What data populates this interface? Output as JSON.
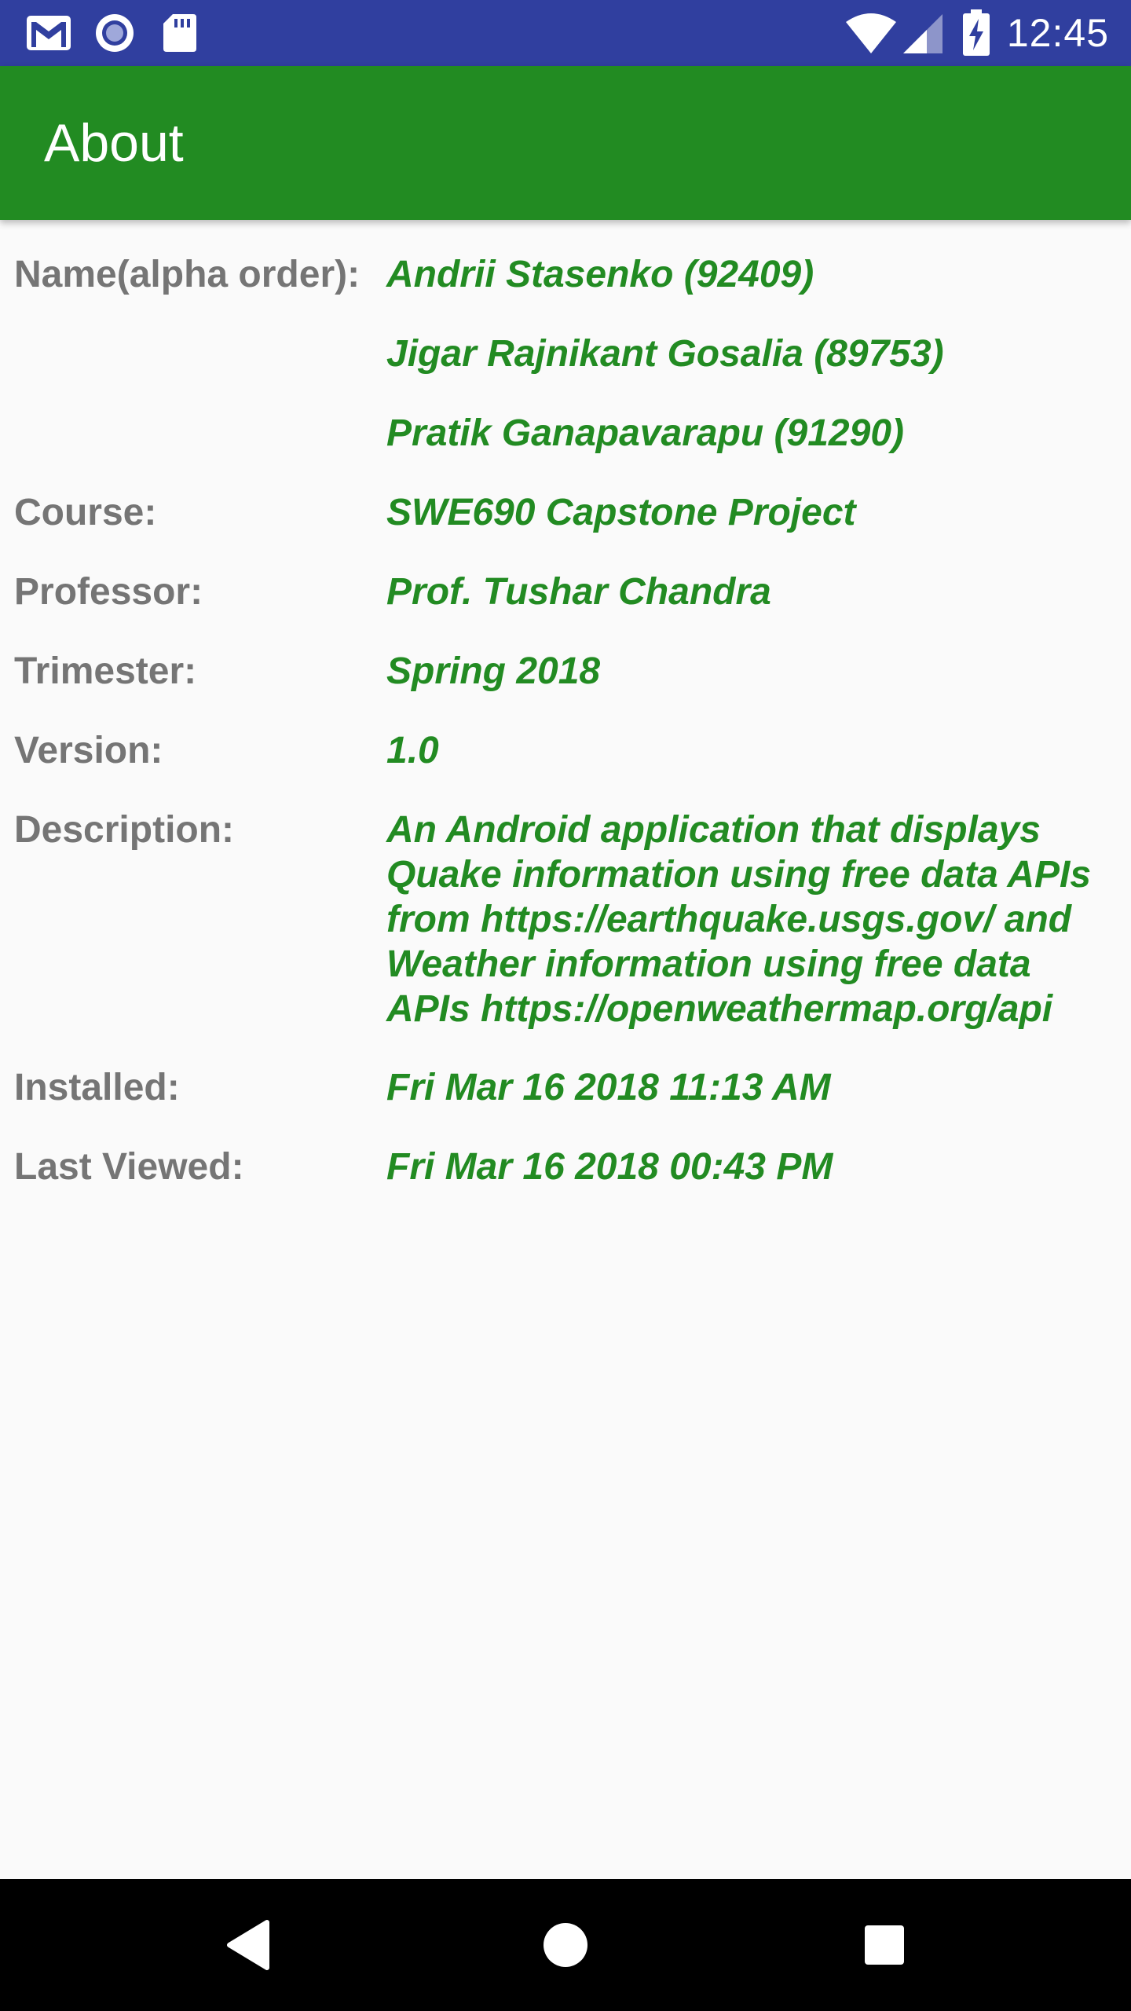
{
  "status_bar": {
    "time": "12:45",
    "icons": [
      "gmail-icon",
      "record-icon",
      "sd-card-icon",
      "wifi-icon",
      "signal-icon",
      "battery-charging-icon"
    ]
  },
  "app_bar": {
    "title": "About"
  },
  "about": {
    "name_label": "Name(alpha order):",
    "names": [
      "Andrii Stasenko (92409)",
      "Jigar Rajnikant Gosalia (89753)",
      "Pratik Ganapavarapu (91290)"
    ],
    "course_label": "Course:",
    "course": "SWE690 Capstone Project",
    "professor_label": "Professor:",
    "professor": "Prof. Tushar Chandra",
    "trimester_label": "Trimester:",
    "trimester": "Spring 2018",
    "version_label": "Version:",
    "version": "1.0",
    "description_label": "Description:",
    "description": "An Android application that displays Quake information using free data APIs from https://earthquake.usgs.gov/ and Weather information using free data APIs https://openweathermap.org/api",
    "installed_label": "Installed:",
    "installed": "Fri Mar 16 2018 11:13 AM",
    "last_viewed_label": "Last Viewed:",
    "last_viewed": "Fri Mar 16 2018 00:43 PM"
  },
  "nav_bar": {
    "buttons": [
      "back-icon",
      "home-icon",
      "recents-icon"
    ]
  },
  "colors": {
    "status_bar": "#303f9f",
    "app_bar": "#228b22",
    "value_text": "#228b22",
    "label_text": "#757575",
    "background": "#fafafa"
  }
}
